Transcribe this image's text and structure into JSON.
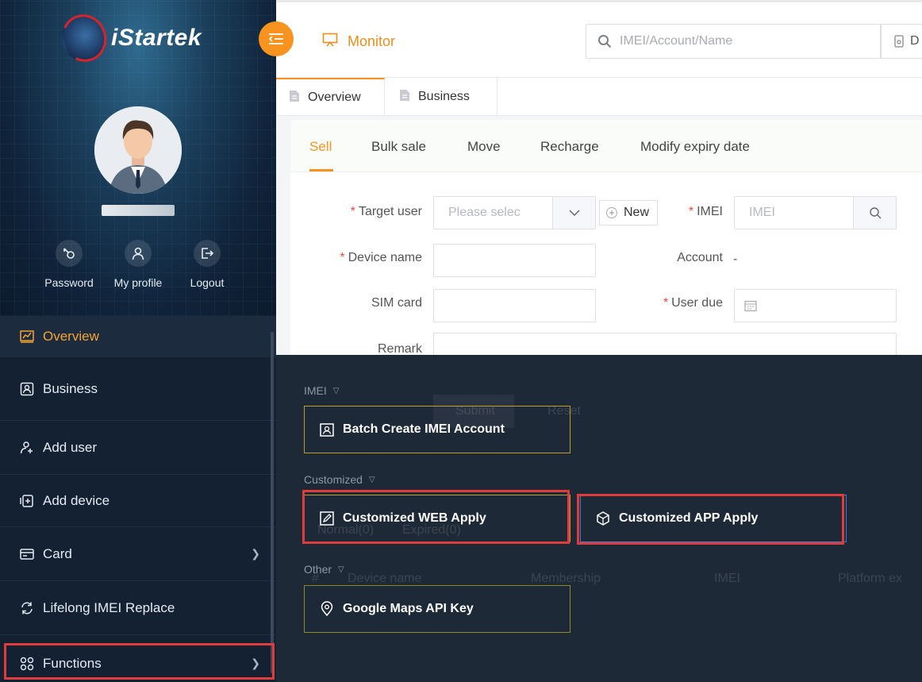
{
  "brand": {
    "logo_text": "iStartek"
  },
  "profile_actions": [
    {
      "label": "Password",
      "icon": "password-icon"
    },
    {
      "label": "My profile",
      "icon": "profile-icon"
    },
    {
      "label": "Logout",
      "icon": "logout-icon"
    }
  ],
  "sidebar": {
    "items": [
      {
        "label": "Overview",
        "icon": "chart-icon",
        "active": true
      },
      {
        "label": "Business",
        "icon": "business-icon"
      },
      {
        "label": "Add user",
        "icon": "add-user-icon"
      },
      {
        "label": "Add device",
        "icon": "add-device-icon"
      },
      {
        "label": "Card",
        "icon": "card-icon",
        "chevron": true
      },
      {
        "label": "Lifelong IMEI Replace",
        "icon": "refresh-icon"
      },
      {
        "label": "Functions",
        "icon": "grid-icon",
        "chevron": true
      }
    ]
  },
  "header": {
    "monitor_label": "Monitor",
    "search_placeholder": "IMEI/Account/Name",
    "d_label": "D"
  },
  "page_tabs": [
    {
      "label": "Overview",
      "active": true
    },
    {
      "label": "Business"
    }
  ],
  "sub_tabs": [
    {
      "label": "Sell",
      "active": true
    },
    {
      "label": "Bulk sale"
    },
    {
      "label": "Move"
    },
    {
      "label": "Recharge"
    },
    {
      "label": "Modify expiry date"
    }
  ],
  "form": {
    "target_user_label": "Target user",
    "target_user_placeholder": "Please selec",
    "new_button": "New",
    "imei_label": "IMEI",
    "imei_placeholder": "IMEI",
    "device_name_label": "Device name",
    "account_label": "Account",
    "account_value": "-",
    "sim_card_label": "SIM card",
    "user_due_label": "User due",
    "remark_label": "Remark",
    "required_mark": "*",
    "submit_label": "Submit",
    "reset_label": "Reset"
  },
  "behind_table": {
    "tab_expired": "Expired(0)",
    "tab_all": "Normal(0)",
    "cols": [
      "#",
      "Device name",
      "Membership",
      "IMEI",
      "Platform ex"
    ]
  },
  "functions_panel": {
    "sections": [
      {
        "label": "IMEI",
        "cards": [
          {
            "label": "Batch Create IMEI Account",
            "icon": "batch-account-icon"
          }
        ]
      },
      {
        "label": "Customized",
        "cards": [
          {
            "label": "Customized WEB Apply",
            "icon": "edit-icon"
          },
          {
            "label": "Customized APP Apply",
            "icon": "cube-icon"
          }
        ]
      },
      {
        "label": "Other",
        "cards": [
          {
            "label": "Google Maps API Key",
            "icon": "map-pin-icon"
          }
        ]
      }
    ]
  },
  "colors": {
    "accent": "#f7931e",
    "sidebar_bg": "#142132",
    "highlight": "#e03c3c",
    "card_border": "#c29b2a"
  }
}
